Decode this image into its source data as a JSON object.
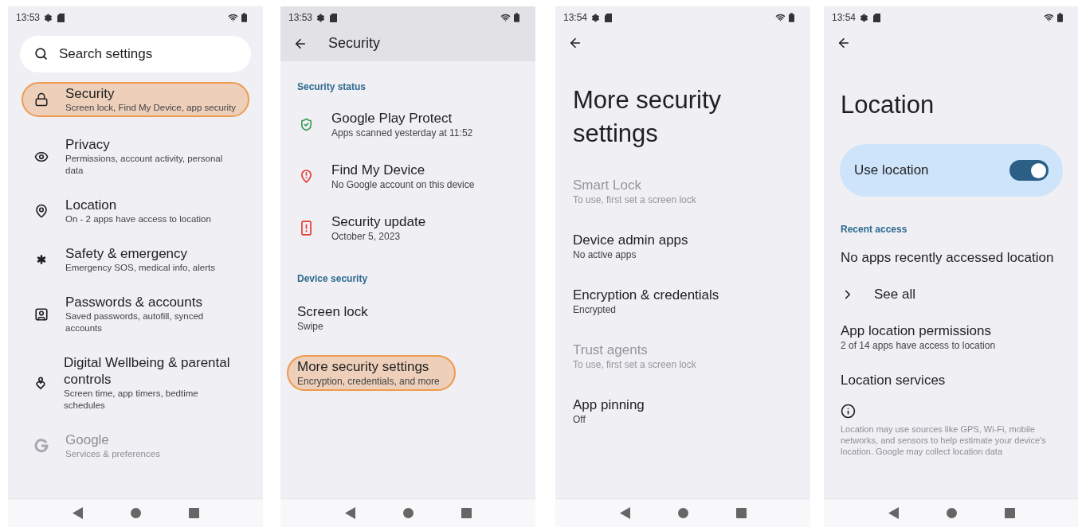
{
  "settings_home": {
    "status": {
      "time": "13:53"
    },
    "search": {
      "placeholder": "Search settings"
    },
    "items": [
      {
        "title": "Security",
        "subtitle": "Screen lock, Find My Device, app security",
        "highlighted": true
      },
      {
        "title": "Privacy",
        "subtitle": "Permissions, account activity, personal data",
        "highlighted": false
      },
      {
        "title": "Location",
        "subtitle": "On - 2 apps have access to location",
        "highlighted": false
      },
      {
        "title": "Safety & emergency",
        "subtitle": "Emergency SOS, medical info, alerts",
        "highlighted": false
      },
      {
        "title": "Passwords & accounts",
        "subtitle": "Saved passwords, autofill, synced accounts",
        "highlighted": false
      },
      {
        "title": "Digital Wellbeing & parental controls",
        "subtitle": "Screen time, app timers, bedtime schedules",
        "highlighted": false
      },
      {
        "title": "Google",
        "subtitle": "Services & preferences",
        "highlighted": false
      }
    ]
  },
  "security": {
    "status": {
      "time": "13:53"
    },
    "title": "Security",
    "sections": [
      {
        "heading": "Security status",
        "items": [
          {
            "title": "Google Play Protect",
            "subtitle": "Apps scanned yesterday at 11:52"
          },
          {
            "title": "Find My Device",
            "subtitle": "No Google account on this device"
          },
          {
            "title": "Security update",
            "subtitle": "October 5, 2023"
          }
        ]
      },
      {
        "heading": "Device security",
        "items": [
          {
            "title": "Screen lock",
            "subtitle": "Swipe",
            "highlighted": false
          },
          {
            "title": "More security settings",
            "subtitle": "Encryption, credentials, and more",
            "highlighted": true
          }
        ]
      }
    ]
  },
  "more_security": {
    "status": {
      "time": "13:54"
    },
    "title": "More security settings",
    "items": [
      {
        "title": "Smart Lock",
        "subtitle": "To use, first set a screen lock",
        "disabled": true
      },
      {
        "title": "Device admin apps",
        "subtitle": "No active apps",
        "disabled": false
      },
      {
        "title": "Encryption & credentials",
        "subtitle": "Encrypted",
        "disabled": false
      },
      {
        "title": "Trust agents",
        "subtitle": "To use, first set a screen lock",
        "disabled": true
      },
      {
        "title": "App pinning",
        "subtitle": "Off",
        "disabled": false
      }
    ]
  },
  "location": {
    "status": {
      "time": "13:54"
    },
    "title": "Location",
    "toggle": {
      "label": "Use location",
      "on": true
    },
    "heading": "Recent access",
    "items": [
      {
        "kind": "text",
        "title": "No apps recently accessed location"
      },
      {
        "kind": "link",
        "title": "See all"
      },
      {
        "kind": "item",
        "title": "App location permissions",
        "subtitle": "2 of 14 apps have access to location"
      },
      {
        "kind": "item",
        "title": "Location services"
      }
    ],
    "footer": "Location may use sources like GPS, Wi-Fi, mobile networks, and sensors to help estimate your device's location. Google may collect location data"
  }
}
